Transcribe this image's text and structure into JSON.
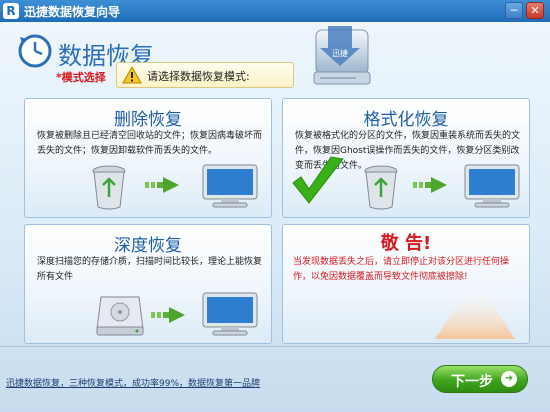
{
  "window": {
    "title": "迅捷数据恢复向导",
    "app_icon_letter": "R",
    "minimize": "─",
    "close": "✕"
  },
  "header": {
    "title": "数据恢复",
    "mode_label": "*模式选择",
    "prompt": "请选择数据恢复模式:",
    "drive_label": "迅捷"
  },
  "cards": {
    "delete": {
      "title": "删除恢复",
      "description": "恢复被删除且已经清空回收站的文件；恢复因病毒破坏而丢失的文件；恢复因卸载软件而丢失的文件。"
    },
    "format": {
      "title": "格式化恢复",
      "description": "恢复被格式化的分区的文件，恢复因重装系统而丢失的文件，恢复因Ghost误操作而丢失的文件，恢复分区类别改变而丢失的文件。"
    },
    "deep": {
      "title": "深度恢复",
      "description": "深度扫描您的存储介质，扫描时间比较长，理论上能恢复所有文件"
    },
    "warning": {
      "title": "敬 告!",
      "description": "当发现数据丢失之后，请立即停止对该分区进行任何操作，以免因数据覆盖而导致文件彻底被擦除!"
    }
  },
  "footer": {
    "text": "迅捷数据恢复，三种恢复模式，成功率99%，数据恢复第一品牌",
    "next_button": "下一步",
    "next_arrow": "➔"
  },
  "colors": {
    "accent": "#2a6fb8",
    "warning": "#d8191f",
    "button": "#3ea51c"
  }
}
